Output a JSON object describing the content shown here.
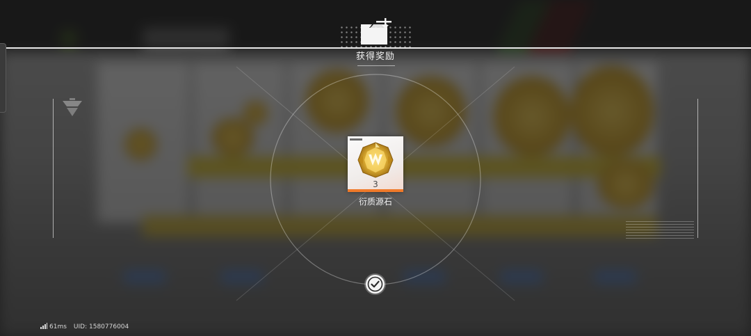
{
  "popup": {
    "title": "获得奖励",
    "confirm_icon": "checkmark-icon",
    "header_icon": "reward-box-icon"
  },
  "rewards": [
    {
      "name": "衍质源石",
      "count": "3",
      "icon": "originium-gem-icon",
      "rarity_color": "#f07a2a"
    }
  ],
  "status": {
    "ping": "61ms",
    "uid": "UID: 1580776004",
    "signal_icon": "signal-bars-icon"
  },
  "colors": {
    "overlay": "#1a1a1a",
    "accent_orange": "#f07a2a",
    "gold": "#d9a92a"
  }
}
